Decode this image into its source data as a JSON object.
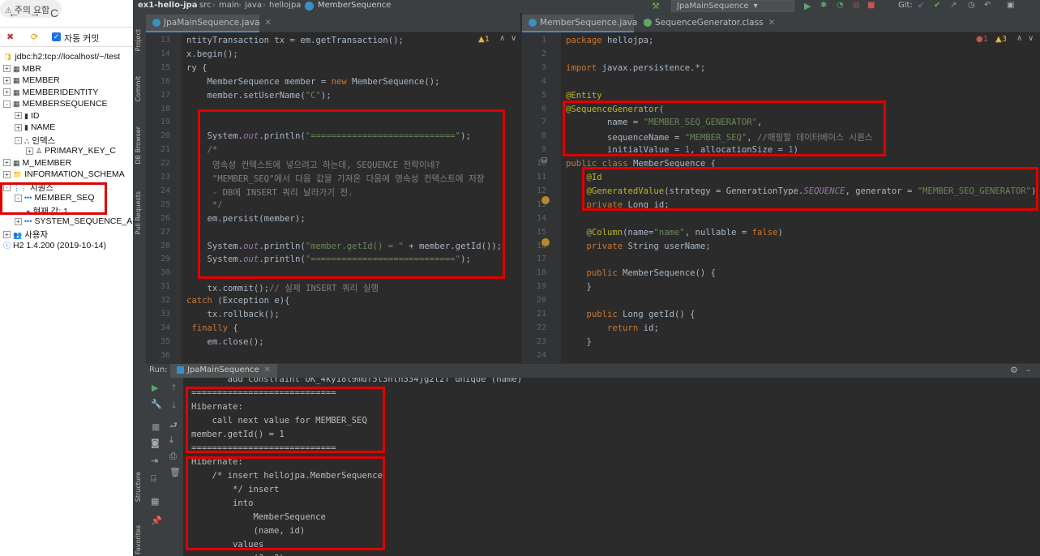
{
  "browser": {
    "nav": {
      "back": "←",
      "forward": "→",
      "reload": "C",
      "url_text": "주의 요함"
    },
    "toolbar": {
      "autocommit_label": "자동 커밋"
    },
    "tree": [
      {
        "label": "jdbc:h2:tcp://localhost/~/test",
        "icon": "database-icon"
      },
      {
        "label": "MBR",
        "pm": "+",
        "icon": "table-icon"
      },
      {
        "label": "MEMBER",
        "pm": "+",
        "icon": "table-icon"
      },
      {
        "label": "MEMBERIDENTITY",
        "pm": "+",
        "icon": "table-icon"
      },
      {
        "label": "MEMBERSEQUENCE",
        "pm": "-",
        "icon": "table-icon"
      },
      {
        "label": "ID",
        "pm": "+",
        "icon": "column-icon"
      },
      {
        "label": "NAME",
        "pm": "+",
        "icon": "column-icon"
      },
      {
        "label": "인덱스",
        "pm": "-",
        "icon": "index-icon"
      },
      {
        "label": "PRIMARY_KEY_C",
        "pm": "+",
        "icon": "key-icon"
      },
      {
        "label": "M_MEMBER",
        "pm": "+",
        "icon": "table-icon"
      },
      {
        "label": "INFORMATION_SCHEMA",
        "pm": "+",
        "icon": "folder-icon"
      },
      {
        "label": "시퀀스",
        "pm": "-",
        "icon": "sequence-icon"
      },
      {
        "label": "MEMBER_SEQ",
        "pm": "-",
        "icon": "sequence-item-icon"
      },
      {
        "label": "현재 값: 1",
        "icon": "dot-icon"
      },
      {
        "label": "SYSTEM_SEQUENCE_A",
        "pm": "+",
        "icon": "sequence-item-icon"
      },
      {
        "label": "사용자",
        "pm": "+",
        "icon": "users-icon"
      },
      {
        "label": "H2 1.4.200 (2019-10-14)",
        "icon": "info-icon"
      }
    ]
  },
  "ide": {
    "breadcrumbs": [
      "ex1-hello-jpa",
      "src",
      "main",
      "java",
      "hellojpa",
      "MemberSequence"
    ],
    "run_config": "JpaMainSequence",
    "git_label": "Git:",
    "side_tools": [
      "Project",
      "Commit",
      "DB Browser",
      "Pull Requests",
      "Structure",
      "Favorites"
    ],
    "left_editor": {
      "tab": "JpaMainSequence.java",
      "warnings": "1",
      "lines": [
        {
          "n": "13",
          "t": "ntityTransaction tx = em.getTransaction();"
        },
        {
          "n": "14",
          "t": "x.begin();"
        },
        {
          "n": "15",
          "t": "ry {"
        },
        {
          "n": "16",
          "t": "    MemberSequence member = new MemberSequence();"
        },
        {
          "n": "17",
          "t": "    member.setUserName(\"C\");"
        },
        {
          "n": "18",
          "t": ""
        },
        {
          "n": "19",
          "t": ""
        },
        {
          "n": "20",
          "t": "    System.out.println(\"============================\");"
        },
        {
          "n": "21",
          "t": "    /*"
        },
        {
          "n": "22",
          "t": "     영속성 컨텍스트에 넣으려고 하는데, SEQUENCE 전략이네?"
        },
        {
          "n": "23",
          "t": "     \"MEMBER_SEQ\"에서 다음 값을 가져온 다음에 영속성 컨텍스트에 저장"
        },
        {
          "n": "24",
          "t": "     - DB에 INSERT 쿼리 날라가기 전."
        },
        {
          "n": "25",
          "t": "     */"
        },
        {
          "n": "26",
          "t": "    em.persist(member);"
        },
        {
          "n": "27",
          "t": ""
        },
        {
          "n": "28",
          "t": "    System.out.println(\"member.getId() = \" + member.getId());"
        },
        {
          "n": "29",
          "t": "    System.out.println(\"============================\");"
        },
        {
          "n": "30",
          "t": ""
        },
        {
          "n": "31",
          "t": "    tx.commit();// 실제 INSERT 쿼리 실행"
        },
        {
          "n": "32",
          "t": "catch (Exception e){"
        },
        {
          "n": "33",
          "t": "    tx.rollback();"
        },
        {
          "n": "34",
          "t": " finally {"
        },
        {
          "n": "35",
          "t": "    em.close();"
        },
        {
          "n": "36",
          "t": ""
        },
        {
          "n": "37",
          "t": "m.close();"
        }
      ]
    },
    "right_editor": {
      "tab1": "MemberSequence.java",
      "tab2": "SequenceGenerator.class",
      "errors": "1",
      "warnings": "3",
      "lines": [
        {
          "n": "1",
          "t": "package hellojpa;"
        },
        {
          "n": "2",
          "t": ""
        },
        {
          "n": "3",
          "t": "import javax.persistence.*;"
        },
        {
          "n": "4",
          "t": ""
        },
        {
          "n": "5",
          "t": "@Entity"
        },
        {
          "n": "6",
          "t": "@SequenceGenerator("
        },
        {
          "n": "7",
          "t": "        name = \"MEMBER_SEQ_GENERATOR\","
        },
        {
          "n": "8",
          "t": "        sequenceName = \"MEMBER_SEQ\", //매핑할 데이터베이스 시퀀스"
        },
        {
          "n": "9",
          "t": "        initialValue = 1, allocationSize = 1)"
        },
        {
          "n": "10",
          "t": "public class MemberSequence {"
        },
        {
          "n": "11",
          "t": "    @Id"
        },
        {
          "n": "12",
          "t": "    @GeneratedValue(strategy = GenerationType.SEQUENCE, generator = \"MEMBER_SEQ_GENERATOR\")"
        },
        {
          "n": "13",
          "t": "    private Long id;"
        },
        {
          "n": "14",
          "t": ""
        },
        {
          "n": "15",
          "t": "    @Column(name=\"name\", nullable = false)"
        },
        {
          "n": "16",
          "t": "    private String userName;"
        },
        {
          "n": "17",
          "t": ""
        },
        {
          "n": "18",
          "t": "    public MemberSequence() {"
        },
        {
          "n": "19",
          "t": "    }"
        },
        {
          "n": "20",
          "t": ""
        },
        {
          "n": "21",
          "t": "    public Long getId() {"
        },
        {
          "n": "22",
          "t": "        return id;"
        },
        {
          "n": "23",
          "t": "    }"
        },
        {
          "n": "24",
          "t": ""
        }
      ]
    },
    "run": {
      "label": "Run:",
      "tab": "JpaMainSequence",
      "console": [
        "       add constraint UK_4ky18l9mdf5t3nth534jg2t2f unique (name)",
        "============================",
        "Hibernate: ",
        "    call next value for MEMBER_SEQ",
        "member.getId() = 1",
        "============================",
        "Hibernate: ",
        "    /* insert hellojpa.MemberSequence",
        "        */ insert ",
        "        into",
        "            MemberSequence",
        "            (name, id) ",
        "        values",
        "            (?, ?)"
      ]
    }
  }
}
